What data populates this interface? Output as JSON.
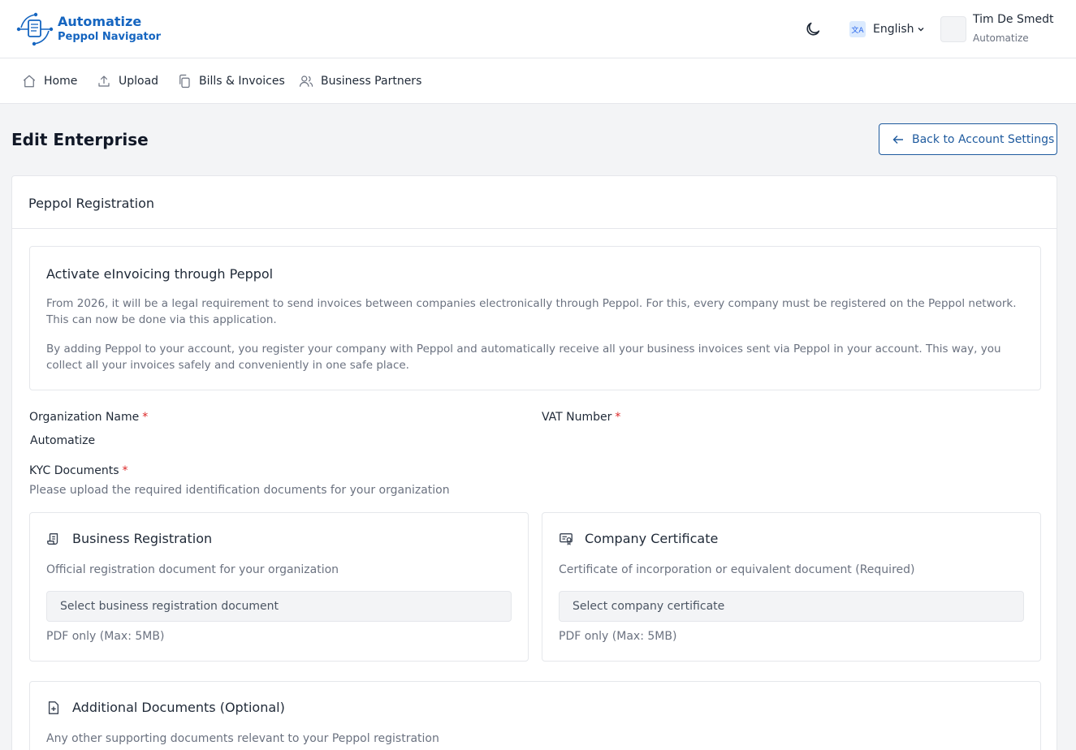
{
  "brand": {
    "name": "Automatize",
    "product": "Peppol Navigator"
  },
  "header": {
    "language": "English",
    "language_icon_text": "文A",
    "user": {
      "name": "Tim De Smedt",
      "org": "Automatize"
    }
  },
  "nav": {
    "items": [
      {
        "label": "Home",
        "icon": "home-icon"
      },
      {
        "label": "Upload",
        "icon": "upload-icon"
      },
      {
        "label": "Bills & Invoices",
        "icon": "copy-icon"
      },
      {
        "label": "Business Partners",
        "icon": "users-icon"
      }
    ]
  },
  "page": {
    "title": "Edit Enterprise",
    "back_label": "Back to Account Settings"
  },
  "card": {
    "title": "Peppol Registration",
    "info": {
      "title": "Activate eInvoicing through Peppol",
      "p1": "From 2026, it will be a legal requirement to send invoices between companies electronically through Peppol. For this, every company must be registered on the Peppol network. This can now be done via this application.",
      "p2": "By adding Peppol to your account, you register your company with Peppol and automatically receive all your business invoices sent via Peppol in your account. This way, you collect all your invoices safely and conveniently in one safe place."
    },
    "fields": {
      "org_label": "Organization Name",
      "org_value": "Automatize",
      "vat_label": "VAT Number",
      "vat_value": "",
      "required_mark": "*"
    },
    "kyc": {
      "label": "KYC Documents",
      "subtitle": "Please upload the required identification documents for your organization",
      "documents": [
        {
          "title": "Business Registration",
          "description": "Official registration document for your organization",
          "placeholder": "Select business registration document",
          "hint": "PDF only (Max: 5MB)"
        },
        {
          "title": "Company Certificate",
          "description": "Certificate of incorporation or equivalent document (Required)",
          "placeholder": "Select company certificate",
          "hint": "PDF only (Max: 5MB)"
        }
      ],
      "additional": {
        "title": "Additional Documents (Optional)",
        "description": "Any other supporting documents relevant to your Peppol registration"
      }
    }
  },
  "colors": {
    "brand": "#1565c0",
    "accent": "#1e5a9e",
    "required": "#dc2626",
    "muted": "#6b7280"
  }
}
